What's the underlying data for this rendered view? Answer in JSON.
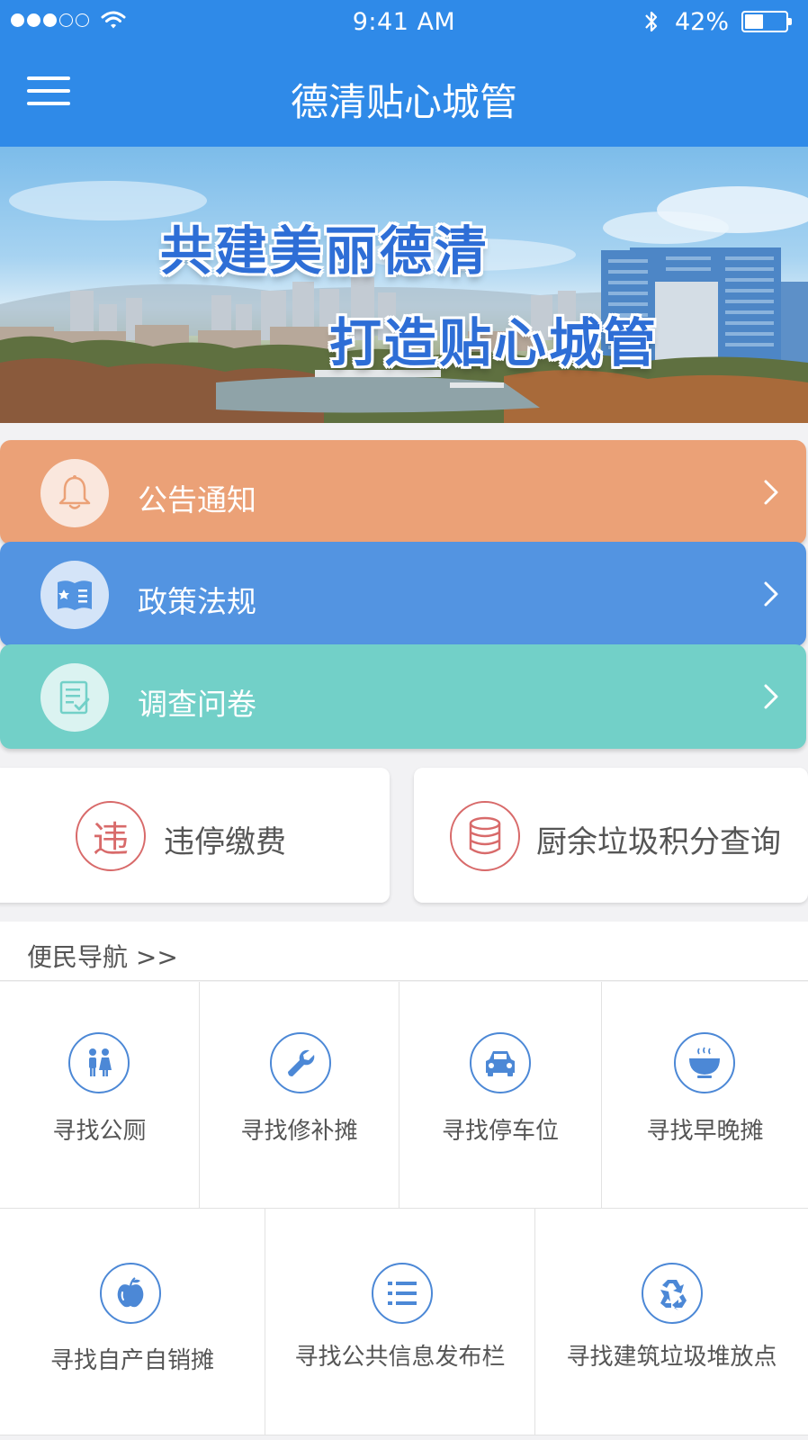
{
  "status_bar": {
    "time": "9:41 AM",
    "battery": "42%",
    "signal_bars": 3
  },
  "header": {
    "title": "德清贴心城管"
  },
  "banner": {
    "line1": "共建美丽德清",
    "line2": "打造贴心城管"
  },
  "menu": [
    {
      "label": "公告通知",
      "icon": "bell-icon",
      "color": "#eba177"
    },
    {
      "label": "政策法规",
      "icon": "book-icon",
      "color": "#5394e1"
    },
    {
      "label": "调查问卷",
      "icon": "survey-icon",
      "color": "#72d0c8"
    }
  ],
  "quick": {
    "fee": {
      "label": "违停缴费",
      "icon_char": "违"
    },
    "kitchen": {
      "label": "厨余垃圾积分查询",
      "icon": "coins-icon"
    }
  },
  "nav": {
    "title": "便民导航 >>",
    "items": [
      {
        "label": "寻找公厕",
        "icon": "toilet-icon"
      },
      {
        "label": "寻找修补摊",
        "icon": "wrench-icon"
      },
      {
        "label": "寻找停车位",
        "icon": "car-icon"
      },
      {
        "label": "寻找早晚摊",
        "icon": "bowl-icon"
      },
      {
        "label": "寻找自产自销摊",
        "icon": "apple-icon"
      },
      {
        "label": "寻找公共信息发布栏",
        "icon": "list-icon"
      },
      {
        "label": "寻找建筑垃圾堆放点",
        "icon": "recycle-icon"
      }
    ]
  },
  "colors": {
    "primary": "#2f8ae8",
    "accent_red": "#d86a6a",
    "icon_blue": "#4c88d6"
  }
}
